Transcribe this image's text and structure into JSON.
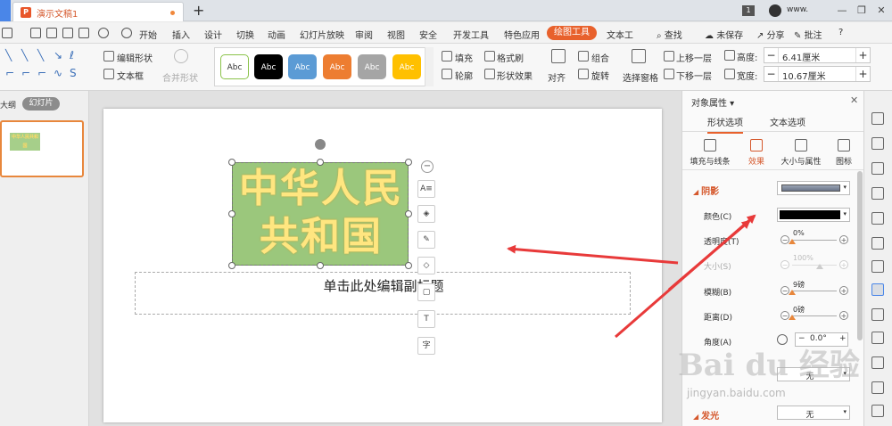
{
  "titlebar": {
    "doc_tab_title": "演示文稿1",
    "add_tab": "+",
    "badge": "1",
    "username": "www.",
    "minimize": "—",
    "restore": "❐",
    "close": "✕"
  },
  "menu": {
    "items": [
      "开始",
      "插入",
      "设计",
      "切换",
      "动画",
      "幻灯片放映",
      "审阅",
      "视图",
      "安全",
      "开发工具",
      "特色应用"
    ],
    "active": "绘图工具",
    "after_active": "文本工",
    "search": "查找",
    "unsaved": "未保存",
    "share": "分享",
    "comment": "批注",
    "help": "?"
  },
  "ribbon": {
    "edit_shape": "编辑形状",
    "text_box": "文本框",
    "merge_shape": "合并形状",
    "styles": [
      {
        "label": "Abc",
        "bg": "#ffffff",
        "fg": "#333333",
        "border": "#8bc34a"
      },
      {
        "label": "Abc",
        "bg": "#000000",
        "fg": "#ffffff",
        "border": "#000000"
      },
      {
        "label": "Abc",
        "bg": "#5b9bd5",
        "fg": "#ffffff",
        "border": "#5b9bd5"
      },
      {
        "label": "Abc",
        "bg": "#ed7d31",
        "fg": "#ffffff",
        "border": "#ed7d31"
      },
      {
        "label": "Abc",
        "bg": "#a5a5a5",
        "fg": "#ffffff",
        "border": "#a5a5a5"
      },
      {
        "label": "Abc",
        "bg": "#ffc000",
        "fg": "#ffffff",
        "border": "#ffc000"
      }
    ],
    "fill": "填充",
    "format_painter": "格式刷",
    "outline": "轮廓",
    "shape_effects": "形状效果",
    "align": "对齐",
    "group": "组合",
    "rotate": "旋转",
    "selection_pane": "选择窗格",
    "bring_forward": "上移一层",
    "send_backward": "下移一层",
    "height_label": "高度:",
    "height_value": "6.41厘米",
    "width_label": "宽度:",
    "width_value": "10.67厘米"
  },
  "leftpanel": {
    "outline": "大纲",
    "slides": "幻灯片",
    "thumb_text": "中华人民共和国"
  },
  "slide": {
    "title_line1": "中华人民",
    "title_line2": "共和国",
    "subtitle_placeholder": "单击此处编辑副标题",
    "float_tools": [
      "A≡",
      "◈",
      "✎",
      "◇",
      "▢",
      "T",
      "字"
    ]
  },
  "rightpanel": {
    "header": "对象属性",
    "tab_shape": "形状选项",
    "tab_text": "文本选项",
    "sub_fill_line": "填充与线条",
    "sub_effects": "效果",
    "sub_size": "大小与属性",
    "sub_icon": "图标",
    "section_shadow": "阴影",
    "color_label": "颜色(C)",
    "transparency_label": "透明度(T)",
    "transparency_value": "0%",
    "size_label": "大小(S)",
    "size_value": "100%",
    "blur_label": "模糊(B)",
    "blur_value": "9磅",
    "distance_label": "距离(D)",
    "distance_value": "0磅",
    "angle_label": "角度(A)",
    "angle_value": "0.0°",
    "preset_value": "无",
    "section_glow": "发光",
    "glow_value": "无",
    "transparency_fraction": 0.0,
    "size_fraction": 0.62,
    "blur_fraction": 0.0,
    "distance_fraction": 0.0
  },
  "watermark": {
    "main": "Bai du 经验",
    "sub": "jingyan.baidu.com"
  },
  "colors": {
    "accent": "#e8612c",
    "title_fill": "#9bc77c",
    "title_text": "#ffe680",
    "arrow": "#e83a3a"
  }
}
